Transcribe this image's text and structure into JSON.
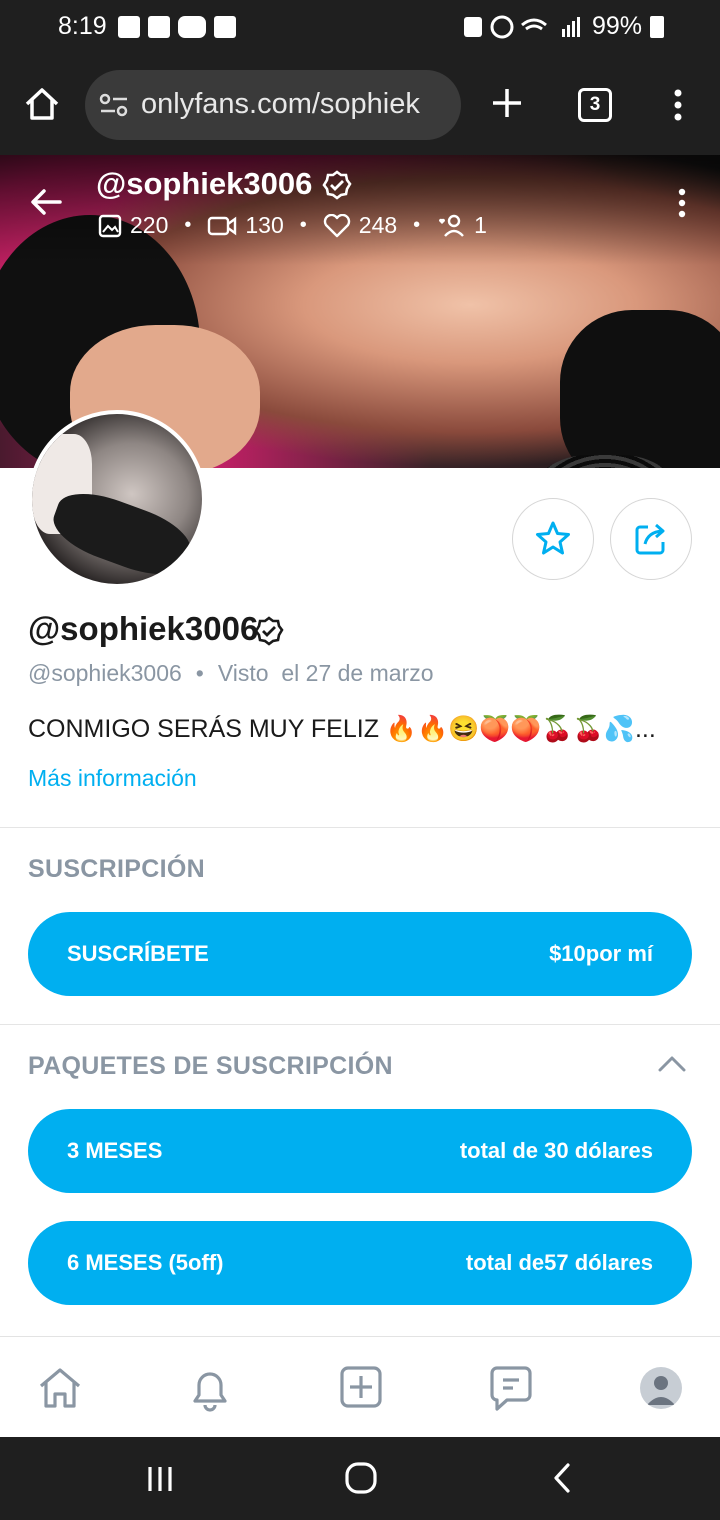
{
  "status_bar": {
    "time": "8:19",
    "battery": "99%"
  },
  "browser": {
    "url": "onlyfans.com/sophiek",
    "tab_count": "3"
  },
  "banner": {
    "username": "@sophiek3006",
    "stats": {
      "photos": "220",
      "videos": "130",
      "likes": "248",
      "fans": "1"
    }
  },
  "profile": {
    "display_name": "@sophiek3006",
    "handle": "@sophiek3006",
    "separator": "•",
    "last_seen": "Visto  el 27 de marzo",
    "bio": "CONMIGO SERÁS MUY FELIZ 🔥🔥😆🍑🍑🍒🍒💦...",
    "more_info": "Más información"
  },
  "subscription": {
    "title": "SUSCRIPCIÓN",
    "button_label": "SUSCRÍBETE",
    "button_price": "$10por mí"
  },
  "bundles": {
    "title": "PAQUETES DE SUSCRIPCIÓN",
    "items": [
      {
        "label": "3 MESES",
        "price": "total de 30 dólares"
      },
      {
        "label": "6 MESES (5off)",
        "price": "total de57 dólares"
      }
    ]
  },
  "colors": {
    "accent": "#00aff0",
    "muted": "#8a96a3",
    "dark_bar": "#1f1f1f"
  },
  "icons": {
    "bottom_nav": [
      "home-icon",
      "bell-icon",
      "add-post-icon",
      "messages-icon",
      "profile-avatar-icon"
    ]
  }
}
